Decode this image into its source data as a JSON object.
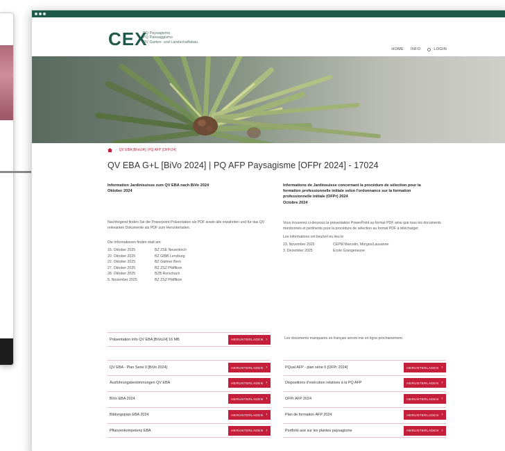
{
  "site": {
    "logo": "CEX",
    "logo_tagline": [
      "PQ Paysagisme",
      "PQ Paesaggismo",
      "QV Garten- und Landschaftsbau"
    ],
    "nav": [
      {
        "label": "HOME"
      },
      {
        "label": "INFO"
      },
      {
        "label": "LOGIN",
        "icon": "search-icon"
      }
    ]
  },
  "breadcrumb": {
    "home_icon": "home-icon",
    "current": "QV EBA [BiVo24] | PQ AFP [OFPr24]"
  },
  "page": {
    "title": "QV EBA G+L [BiVo 2024] | PQ AFP Paysagisme [OFPr 2024] - 17024"
  },
  "left_column": {
    "intro_title": [
      "Information Jardinisuisse zum QV EBA nach BiVo 2024",
      "Oktober 2024"
    ],
    "intro_body": "Nachfolgend finden Sie die Powerpoint-Präsentation als PDF sowie alle erwähnten und für das QV relevanten Dokumente als PDF zum Herunterladen.",
    "dates_intro": "Die Informationen finden statt am:",
    "dates": [
      {
        "date": "15. Oktober 2025",
        "location": "BZ ZSE Neuenkirch"
      },
      {
        "date": "20. Oktober 2025",
        "location": "BZ GIBB Lenzburg"
      },
      {
        "date": "22. Oktober 2025",
        "location": "BZ Gärtner Bern"
      },
      {
        "date": "27. Oktober 2025",
        "location": "BZ ZSZ Pfäffikon"
      },
      {
        "date": "28. Oktober 2025",
        "location": "BZB Rorschach"
      },
      {
        "date": "5. November 2025",
        "location": "BZ ZSZ Pfäffikon"
      }
    ],
    "presentation": {
      "label": "Präsentation Info QV EBA [BiVo24] 16 MB",
      "button": "HERUNTERLADEN"
    },
    "downloads": [
      {
        "label": "QV EBA - Plan Serie 0 [BiVo 2024]",
        "button": "HERUNTERLADEN"
      },
      {
        "label": "Ausführungsbestimmungen QV EBA",
        "button": "HERUNTERLADEN"
      },
      {
        "label": "BiVo EBA 2024",
        "button": "HERUNTERLADEN"
      },
      {
        "label": "Bildungsplan EBA 2024",
        "button": "HERUNTERLADEN"
      },
      {
        "label": "Pflanzenkompetenz EBA",
        "button": "HERUNTERLADEN"
      }
    ]
  },
  "right_column": {
    "intro_title": [
      "Informations de Jardinsuisse concernant la procédure de sélection pour la",
      "formation professionnelle initiale selon l'ordonnance sur la formation",
      "professionnelle initiale (OFPr) 2024",
      "Octobre 2024"
    ],
    "intro_body": "Vous trouverez ci-dessous la présentation PowerPoint au format PDF ainsi que tous les documents mentionnés et pertinents pour la procédure de sélection au format PDF à télécharger.",
    "dates_intro": "Les informations ont lieu/ont eu lieu le",
    "dates": [
      {
        "date": "23. November 2025",
        "location": "CEPM Marcelin, Morges/Lausanne"
      },
      {
        "date": "3. Dezember 2025",
        "location": "Ecole Grangeneuve"
      }
    ],
    "note": "Les documents manquants en français seront mis en ligne prochainement.",
    "downloads": [
      {
        "label": "PQual AFP - plan série 0 [OFPr 2024]",
        "button": "HERUNTERLADEN"
      },
      {
        "label": "Dispositions d'exécution relatives à la PQ AFP",
        "button": "HERUNTERLADEN"
      },
      {
        "label": "OFPr AFP 2024",
        "button": "HERUNTERLADEN"
      },
      {
        "label": "Plan de formation AFP 2024",
        "button": "HERUNTERLADEN"
      },
      {
        "label": "Portfolio axé sur les plantes paysagisme",
        "button": "HERUNTERLADEN"
      }
    ]
  },
  "colors": {
    "brand_green": "#1f5a49",
    "accent_red": "#c41e3a"
  }
}
